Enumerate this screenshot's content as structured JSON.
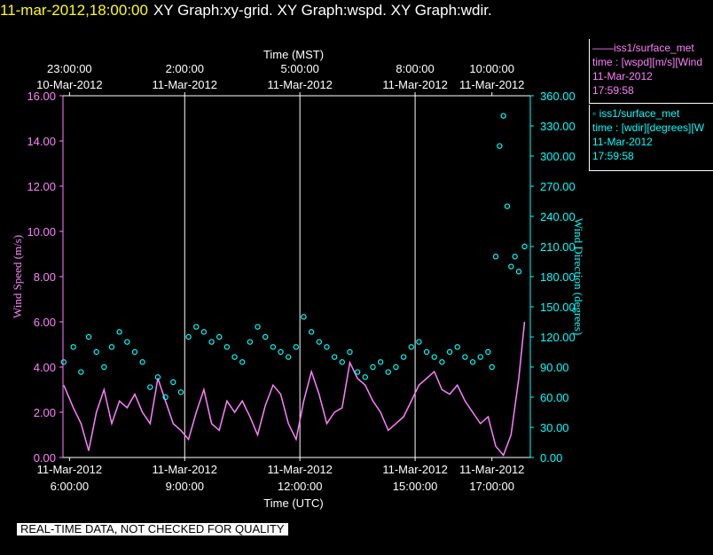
{
  "header": {
    "datetime": "11-mar-2012,18:00:00",
    "graphs": "XY Graph:xy-grid.  XY Graph:wspd.  XY Graph:wdir."
  },
  "legends": [
    {
      "name": "——iss1/surface_met",
      "line1": "time : [wspd][m/s][Wind",
      "line2": "11-Mar-2012",
      "line3": "17:59:58",
      "color": "#ff80ff"
    },
    {
      "name": "◦ iss1/surface_met",
      "line1": "time : [wdir][degrees][W",
      "line2": "11-Mar-2012",
      "line3": "17:59:58",
      "color": "#00ffff"
    }
  ],
  "footer": {
    "quality_note": "REAL-TIME DATA, NOT CHECKED FOR QUALITY"
  },
  "chart_data": {
    "type": "line",
    "top_axis_title": "Time (MST)",
    "bottom_axis_title": "Time (UTC)",
    "ylabel_left": "Wind Speed (m/s)",
    "ylabel_right": "Wind Direction (degrees)",
    "x_range_utc_hours": [
      5.83,
      18.0
    ],
    "vertical_grid_utc_hours": [
      9,
      12,
      15
    ],
    "top_ticks": [
      {
        "utc_hour": 6,
        "line1": "23:00:00",
        "line2": "10-Mar-2012"
      },
      {
        "utc_hour": 9,
        "line1": "2:00:00",
        "line2": "11-Mar-2012"
      },
      {
        "utc_hour": 12,
        "line1": "5:00:00",
        "line2": "11-Mar-2012"
      },
      {
        "utc_hour": 15,
        "line1": "8:00:00",
        "line2": "11-Mar-2012"
      },
      {
        "utc_hour": 17,
        "line1": "10:00:00",
        "line2": "11-Mar-2012"
      }
    ],
    "bottom_ticks": [
      {
        "utc_hour": 6,
        "line1": "11-Mar-2012",
        "line2": "6:00:00"
      },
      {
        "utc_hour": 9,
        "line1": "11-Mar-2012",
        "line2": "9:00:00"
      },
      {
        "utc_hour": 12,
        "line1": "11-Mar-2012",
        "line2": "12:00:00"
      },
      {
        "utc_hour": 15,
        "line1": "11-Mar-2012",
        "line2": "15:00:00"
      },
      {
        "utc_hour": 17,
        "line1": "11-Mar-2012",
        "line2": "17:00:00"
      }
    ],
    "left_axis": {
      "range": [
        0,
        16
      ],
      "ticks": [
        "0.00",
        "2.00",
        "4.00",
        "6.00",
        "8.00",
        "10.00",
        "12.00",
        "14.00",
        "16.00"
      ],
      "color": "#ff80ff"
    },
    "right_axis": {
      "range": [
        0,
        360
      ],
      "ticks": [
        "0.00",
        "30.00",
        "60.00",
        "90.00",
        "120.00",
        "150.00",
        "180.00",
        "210.00",
        "240.00",
        "270.00",
        "300.00",
        "330.00",
        "360.00"
      ],
      "color": "#00ffff"
    },
    "series": [
      {
        "name": "iss1/surface_met wspd",
        "style": "line",
        "color": "#ff80ff",
        "x": [
          5.85,
          6.1,
          6.3,
          6.5,
          6.7,
          6.9,
          7.1,
          7.3,
          7.5,
          7.7,
          7.9,
          8.1,
          8.3,
          8.5,
          8.7,
          8.9,
          9.1,
          9.3,
          9.5,
          9.7,
          9.9,
          10.1,
          10.3,
          10.5,
          10.7,
          10.9,
          11.1,
          11.3,
          11.5,
          11.7,
          11.9,
          12.1,
          12.3,
          12.5,
          12.7,
          12.9,
          13.1,
          13.3,
          13.5,
          13.7,
          13.9,
          14.1,
          14.3,
          14.5,
          14.7,
          14.9,
          15.1,
          15.3,
          15.5,
          15.7,
          15.9,
          16.1,
          16.3,
          16.5,
          16.7,
          16.9,
          17.1,
          17.3,
          17.5,
          17.7,
          17.85
        ],
        "values": [
          3.2,
          2.2,
          1.5,
          0.3,
          2.0,
          3.0,
          1.5,
          2.5,
          2.2,
          2.8,
          2.0,
          1.5,
          3.5,
          2.5,
          1.5,
          1.2,
          0.8,
          2.0,
          3.0,
          1.5,
          1.2,
          2.5,
          2.0,
          2.5,
          1.8,
          1.0,
          2.3,
          3.2,
          2.8,
          1.5,
          0.8,
          2.5,
          3.8,
          2.8,
          1.5,
          2.0,
          2.2,
          4.2,
          3.5,
          3.2,
          2.5,
          2.0,
          1.2,
          1.5,
          1.8,
          2.5,
          3.2,
          3.5,
          3.8,
          3.0,
          2.8,
          3.2,
          2.5,
          2.0,
          1.5,
          1.8,
          0.5,
          0.1,
          1.0,
          3.5,
          6.0
        ]
      },
      {
        "name": "iss1/surface_met wdir",
        "style": "markers",
        "color": "#00ffff",
        "x": [
          5.85,
          6.1,
          6.3,
          6.5,
          6.7,
          6.9,
          7.1,
          7.3,
          7.5,
          7.7,
          7.9,
          8.1,
          8.3,
          8.5,
          8.7,
          8.9,
          9.1,
          9.3,
          9.5,
          9.7,
          9.9,
          10.1,
          10.3,
          10.5,
          10.7,
          10.9,
          11.1,
          11.3,
          11.5,
          11.7,
          11.9,
          12.1,
          12.3,
          12.5,
          12.7,
          12.9,
          13.1,
          13.3,
          13.5,
          13.7,
          13.9,
          14.1,
          14.3,
          14.5,
          14.7,
          14.9,
          15.1,
          15.3,
          15.5,
          15.7,
          15.9,
          16.1,
          16.3,
          16.5,
          16.7,
          16.9,
          17.0,
          17.1,
          17.2,
          17.3,
          17.4,
          17.5,
          17.6,
          17.7,
          17.85
        ],
        "values": [
          95,
          110,
          85,
          120,
          105,
          90,
          110,
          125,
          115,
          105,
          95,
          70,
          80,
          60,
          75,
          65,
          120,
          130,
          125,
          115,
          120,
          110,
          100,
          95,
          115,
          130,
          120,
          110,
          105,
          100,
          110,
          140,
          125,
          115,
          110,
          100,
          95,
          105,
          85,
          80,
          90,
          95,
          85,
          90,
          100,
          110,
          115,
          105,
          100,
          95,
          105,
          110,
          100,
          95,
          100,
          105,
          90,
          200,
          310,
          340,
          250,
          190,
          200,
          185,
          210
        ]
      }
    ]
  }
}
